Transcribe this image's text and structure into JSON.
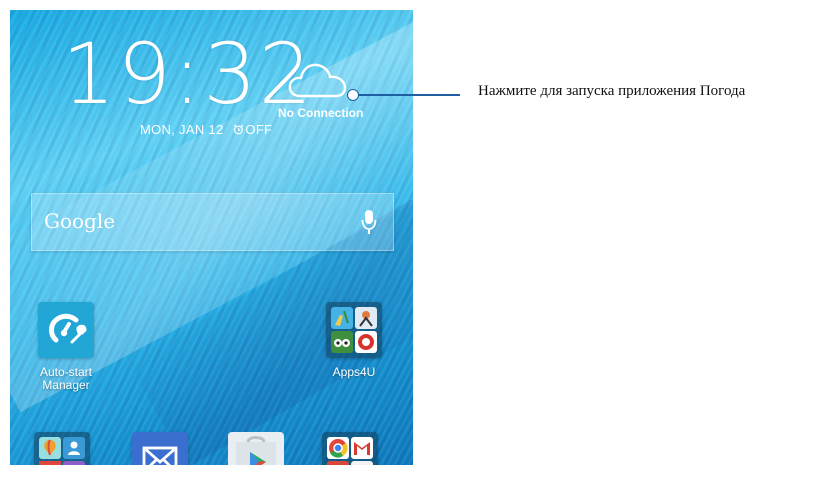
{
  "lockscreen": {
    "time": "19:32",
    "date": "MON, JAN 12",
    "alarm_status": "OFF",
    "weather": {
      "icon": "cloud-icon",
      "status": "No Connection"
    }
  },
  "search": {
    "brand": "Google",
    "mic_icon": "microphone-icon"
  },
  "apps": [
    {
      "label": "Auto-start Manager",
      "icon": "auto-start-manager-icon"
    },
    {
      "label": "Apps4U",
      "icon": "folder-icon"
    }
  ],
  "dock": [
    {
      "icon": "productivity-folder-icon"
    },
    {
      "icon": "email-icon"
    },
    {
      "icon": "play-store-icon"
    },
    {
      "icon": "google-folder-icon"
    }
  ],
  "callout": {
    "text": "Нажмите для запуска приложения Погода"
  },
  "colors": {
    "wallpaper": "#1aa5e0",
    "callout_line": "#1d5fa0"
  }
}
